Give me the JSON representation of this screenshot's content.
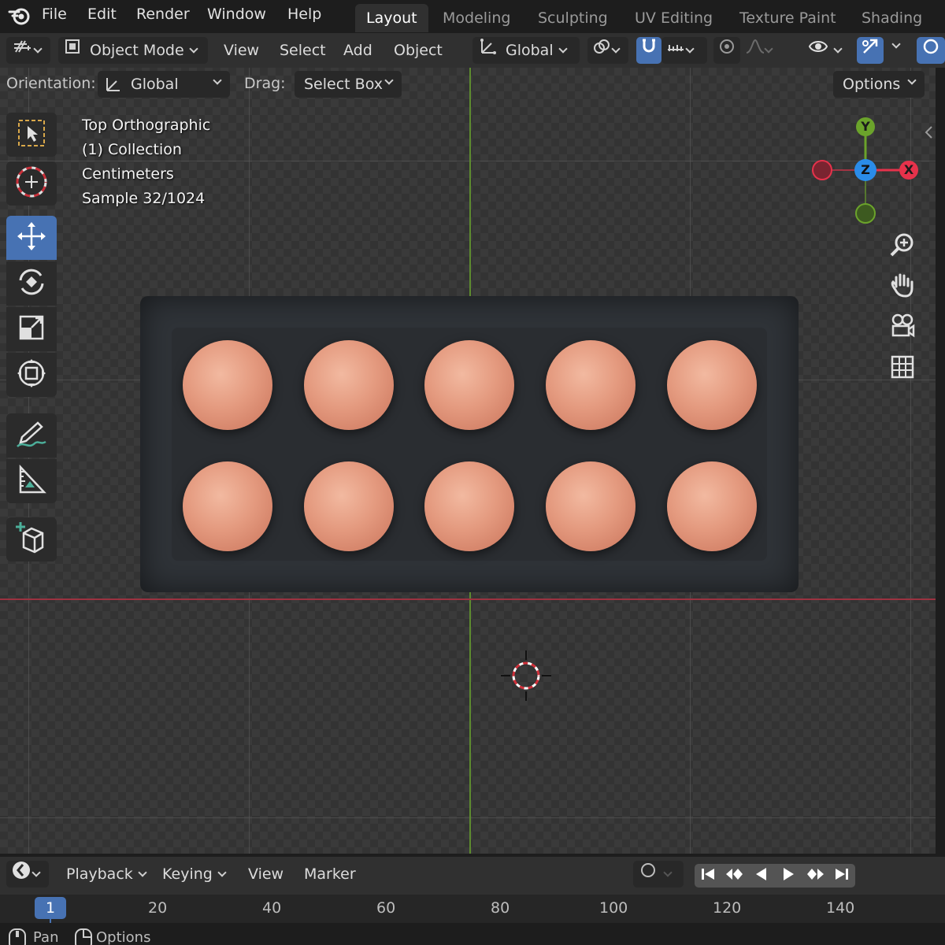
{
  "menubar": {
    "items": [
      "File",
      "Edit",
      "Render",
      "Window",
      "Help"
    ]
  },
  "workspaces": [
    "Layout",
    "Modeling",
    "Sculpting",
    "UV Editing",
    "Texture Paint",
    "Shading"
  ],
  "header": {
    "mode": "Object Mode",
    "menus": [
      "View",
      "Select",
      "Add",
      "Object"
    ],
    "transform_orientation": "Global"
  },
  "tool_settings": {
    "orientation_label": "Orientation:",
    "orientation_value": "Global",
    "drag_label": "Drag:",
    "drag_value": "Select Box",
    "options_label": "Options"
  },
  "viewport": {
    "view_name": "Top Orthographic",
    "collection": "(1) Collection",
    "units": "Centimeters",
    "sample": "Sample 32/1024"
  },
  "gizmo": {
    "x_label": "X",
    "y_label": "Y",
    "z_label": "Z",
    "colors": {
      "x": "#e6324b",
      "y": "#6ba32b",
      "z": "#2a8ce8"
    }
  },
  "timeline": {
    "menus": [
      "Playback",
      "Keying",
      "View",
      "Marker"
    ],
    "current_frame": "1",
    "ticks": [
      "20",
      "40",
      "60",
      "80",
      "100",
      "120",
      "140"
    ]
  },
  "statusbar": {
    "items": [
      "Pan",
      "Options"
    ]
  },
  "accent_color": "#4772b3"
}
